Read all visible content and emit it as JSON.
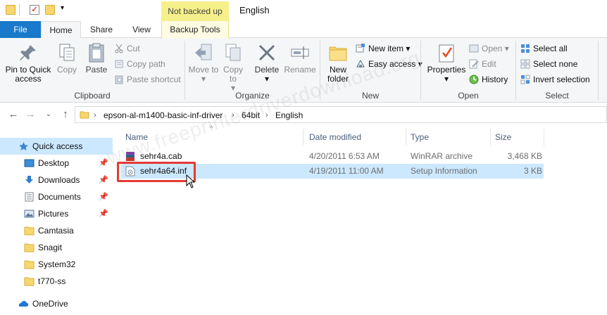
{
  "quick_access_toolbar": {
    "icons": [
      "folder-icon",
      "properties-check-icon",
      "new-folder-icon"
    ],
    "dropdown_glyph": "▾"
  },
  "contextual_tab": {
    "label": "Not backed up"
  },
  "window": {
    "title": "English"
  },
  "ribbon_tabs": [
    {
      "label": "File",
      "accent": "#1979ca"
    },
    {
      "label": "Home"
    },
    {
      "label": "Share"
    },
    {
      "label": "View"
    },
    {
      "label": "Backup Tools"
    }
  ],
  "ribbon": {
    "clipboard": {
      "label": "Clipboard",
      "pin": "Pin to Quick access",
      "copy": "Copy",
      "paste": "Paste",
      "cut": "Cut",
      "copy_path": "Copy path",
      "paste_shortcut": "Paste shortcut"
    },
    "organize": {
      "label": "Organize",
      "move_to": "Move to",
      "copy_to": "Copy to",
      "delete": "Delete",
      "rename": "Rename"
    },
    "new": {
      "label": "New",
      "new_folder": "New folder",
      "new_item": "New item",
      "easy_access": "Easy access"
    },
    "open": {
      "label": "Open",
      "properties": "Properties",
      "open": "Open",
      "edit": "Edit",
      "history": "History"
    },
    "select": {
      "label": "Select",
      "select_all": "Select all",
      "select_none": "Select none",
      "invert_selection": "Invert selection"
    }
  },
  "address_bar": {
    "crumbs": [
      "epson-al-m1400-basic-inf-driver",
      "64bit",
      "English"
    ],
    "separator": "›"
  },
  "nav_pane": {
    "items": [
      {
        "label": "Quick access",
        "icon": "star-icon",
        "selected": true
      },
      {
        "label": "Desktop",
        "icon": "desktop-icon",
        "pinned": true
      },
      {
        "label": "Downloads",
        "icon": "download-icon",
        "pinned": true
      },
      {
        "label": "Documents",
        "icon": "documents-icon",
        "pinned": true
      },
      {
        "label": "Pictures",
        "icon": "pictures-icon",
        "pinned": true
      },
      {
        "label": "Camtasia",
        "icon": "folder-icon"
      },
      {
        "label": "Snagit",
        "icon": "folder-icon"
      },
      {
        "label": "System32",
        "icon": "folder-icon"
      },
      {
        "label": "t770-ss",
        "icon": "folder-icon"
      },
      {
        "label": "OneDrive",
        "icon": "cloud-icon"
      }
    ]
  },
  "file_list": {
    "columns": [
      "Name",
      "Date modified",
      "Type",
      "Size"
    ],
    "rows": [
      {
        "name": "sehr4a.cab",
        "date": "4/20/2011 6:53 AM",
        "type": "WinRAR archive",
        "size": "3,468 KB",
        "icon": "winrar-archive-icon"
      },
      {
        "name": "sehr4a64.inf",
        "date": "4/19/2011 11:00 AM",
        "type": "Setup Information",
        "size": "3 KB",
        "icon": "setup-info-icon",
        "selected": true
      }
    ]
  },
  "watermark": {
    "text": "www.freeprinterdriverdownload.org"
  },
  "colors": {
    "selection": "#cce8ff",
    "highlight_box": "#e53935",
    "file_tab": "#1979ca",
    "context_tab": "#f6f08a"
  }
}
